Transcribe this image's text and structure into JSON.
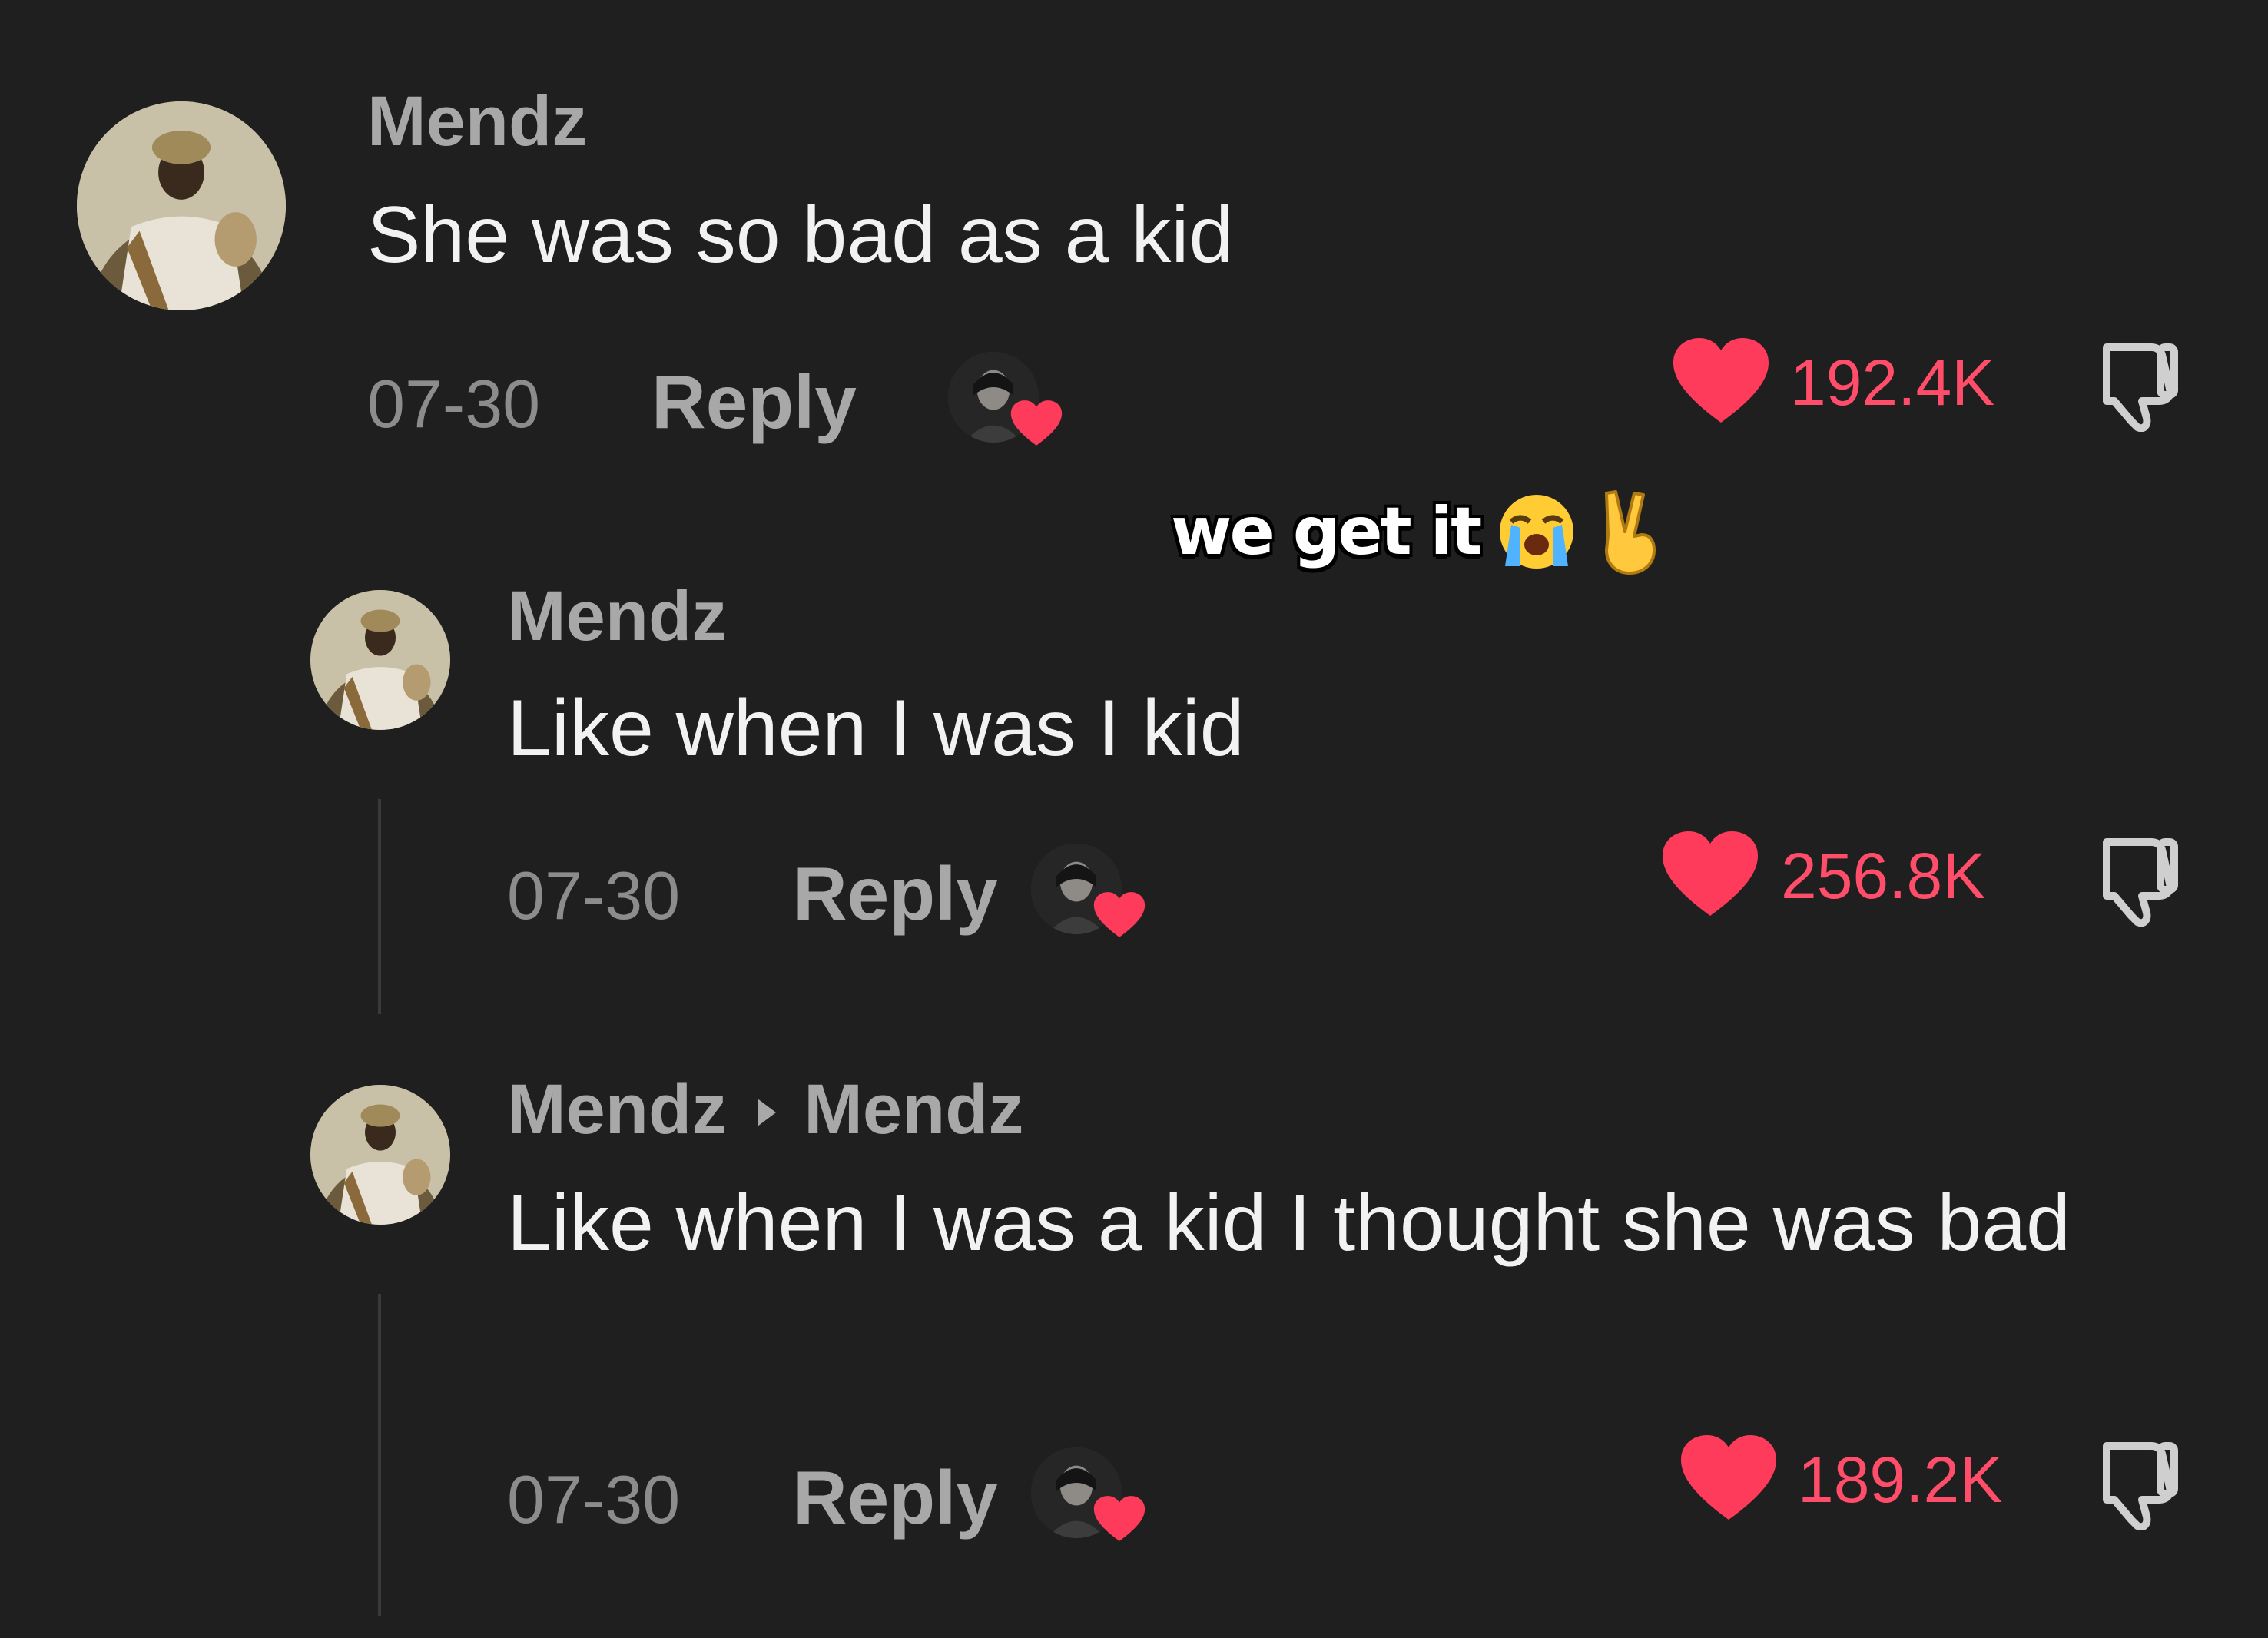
{
  "sticker": {
    "text": "we get it",
    "emojis": [
      "loudly-crying-face-icon",
      "victory-hand-icon"
    ]
  },
  "comments": [
    {
      "username": "Mendz",
      "text": "She was so bad as a kid",
      "date": "07-30",
      "reply_label": "Reply",
      "likes": "192.4K",
      "creator_liked": true
    },
    {
      "username": "Mendz",
      "text": "Like when I was I kid",
      "date": "07-30",
      "reply_label": "Reply",
      "likes": "256.8K",
      "creator_liked": true
    },
    {
      "username": "Mendz",
      "reply_to": "Mendz",
      "text": "Like when I was a kid I thought she was bad",
      "date": "07-30",
      "reply_label": "Reply",
      "likes": "189.2K",
      "creator_liked": true
    }
  ],
  "colors": {
    "background": "#1f1f1f",
    "like": "#ff4d6a",
    "username": "#a8a8a8",
    "text": "#f2f2f2"
  }
}
